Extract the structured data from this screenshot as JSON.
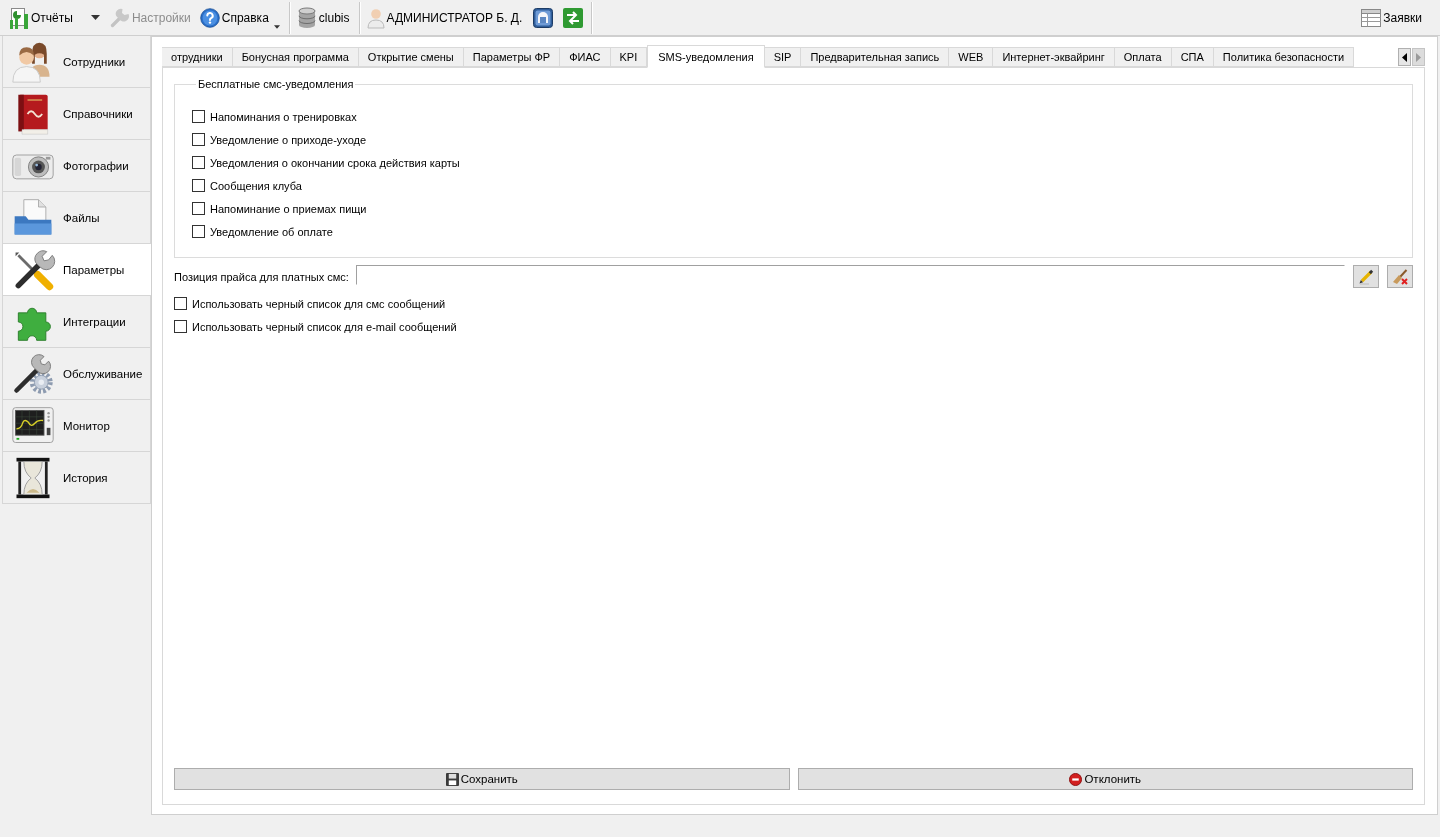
{
  "toolbar": {
    "items": [
      {
        "kind": "button",
        "label": "Отчёты",
        "disabled": false
      },
      {
        "kind": "arrow",
        "disabled": false
      },
      {
        "kind": "button",
        "label": "Настройки",
        "disabled": true
      },
      {
        "kind": "menu",
        "label": "Справка",
        "disabled": false
      },
      {
        "kind": "separator"
      },
      {
        "kind": "button",
        "label": "clubis",
        "disabled": false
      },
      {
        "kind": "separator"
      },
      {
        "kind": "button",
        "label": "АДМИНИСТРАТОР Б. Д.",
        "disabled": false
      },
      {
        "kind": "icon",
        "disabled": false
      },
      {
        "kind": "icon",
        "disabled": false
      },
      {
        "kind": "separator"
      }
    ],
    "right_items": [
      {
        "kind": "button",
        "label": "Заявки",
        "disabled": false
      }
    ]
  },
  "sidebar": {
    "items": [
      {
        "label": "Сотрудники",
        "selected": false
      },
      {
        "label": "Справочники",
        "selected": false
      },
      {
        "label": "Фотографии",
        "selected": false
      },
      {
        "label": "Файлы",
        "selected": false
      },
      {
        "label": "Параметры",
        "selected": true
      },
      {
        "label": "Интеграции",
        "selected": false
      },
      {
        "label": "Обслуживание",
        "selected": false
      },
      {
        "label": "Монитор",
        "selected": false
      },
      {
        "label": "История",
        "selected": false
      }
    ]
  },
  "tabs": [
    {
      "label": "отрудники",
      "selected": false
    },
    {
      "label": "Бонусная программа",
      "selected": false
    },
    {
      "label": "Открытие смены",
      "selected": false
    },
    {
      "label": "Параметры ФР",
      "selected": false
    },
    {
      "label": "ФИАС",
      "selected": false
    },
    {
      "label": "KPI",
      "selected": false
    },
    {
      "label": "SMS-уведомления",
      "selected": true
    },
    {
      "label": "SIP",
      "selected": false
    },
    {
      "label": "Предварительная запись",
      "selected": false
    },
    {
      "label": "WEB",
      "selected": false
    },
    {
      "label": "Интернет-эквайринг",
      "selected": false
    },
    {
      "label": "Оплата",
      "selected": false
    },
    {
      "label": "СПА",
      "selected": false
    },
    {
      "label": "Политика безопасности",
      "selected": false
    }
  ],
  "free_sms": {
    "title": "Бесплатные смс-уведомления",
    "options": [
      {
        "label": "Напоминания о тренировках",
        "checked": false
      },
      {
        "label": "Уведомление о приходе-уходе",
        "checked": false
      },
      {
        "label": "Уведомления о окончании срока действия карты",
        "checked": false
      },
      {
        "label": "Сообщения клуба",
        "checked": false
      },
      {
        "label": "Напоминание о приемах пищи",
        "checked": false
      },
      {
        "label": "Уведомление об оплате",
        "checked": false
      }
    ]
  },
  "price_position": {
    "label": "Позиция прайса для платных смс:"
  },
  "blacklist_options": [
    {
      "label": "Использовать черный список для смс сообщений",
      "checked": false
    },
    {
      "label": "Использовать черный список для e-mail сообщений",
      "checked": false
    }
  ],
  "buttons": [
    {
      "label": "Сохранить"
    },
    {
      "label": "Отклонить"
    }
  ]
}
